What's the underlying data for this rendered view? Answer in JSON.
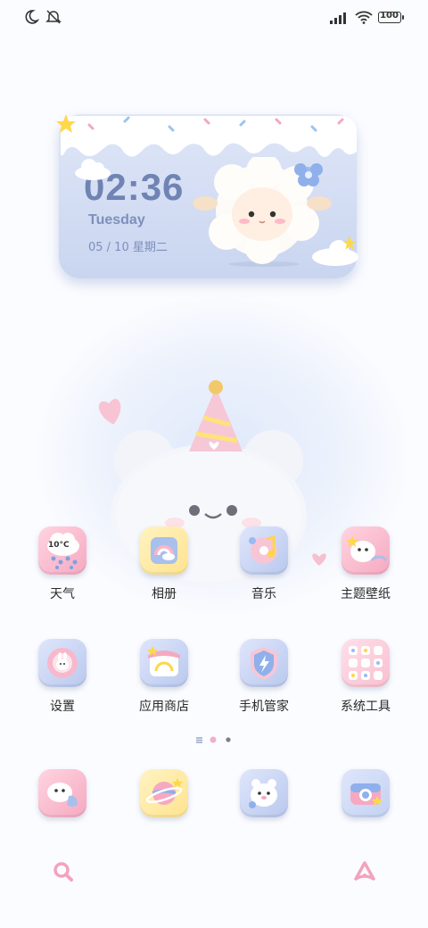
{
  "status_bar": {
    "battery": "100",
    "icons": [
      "moon-icon",
      "mute-icon",
      "signal-icon",
      "wifi-icon",
      "battery-icon"
    ]
  },
  "clock_widget": {
    "time": "02:36",
    "day": "Tuesday",
    "date": "05 / 10 星期二"
  },
  "apps_row1": [
    {
      "label": "天气",
      "icon": "weather-icon",
      "sub": "10°C"
    },
    {
      "label": "相册",
      "icon": "gallery-icon"
    },
    {
      "label": "音乐",
      "icon": "music-icon"
    },
    {
      "label": "主题壁纸",
      "icon": "theme-wallpaper-icon"
    }
  ],
  "apps_row2": [
    {
      "label": "设置",
      "icon": "settings-icon"
    },
    {
      "label": "应用商店",
      "icon": "app-store-icon"
    },
    {
      "label": "手机管家",
      "icon": "phone-manager-icon"
    },
    {
      "label": "系统工具",
      "icon": "system-tools-icon"
    }
  ],
  "dock": [
    "phone-icon",
    "browser-icon",
    "contacts-icon",
    "camera-icon"
  ],
  "page_indicator": {
    "count": 3,
    "active": 1
  },
  "bottom_bar": [
    "search-icon",
    "assistant-icon"
  ],
  "colors": {
    "accent_pink": "#f6b8cc",
    "accent_blue": "#c9d5f0",
    "text_dark": "#2a2a2a",
    "clock_text": "#6f84b3"
  }
}
